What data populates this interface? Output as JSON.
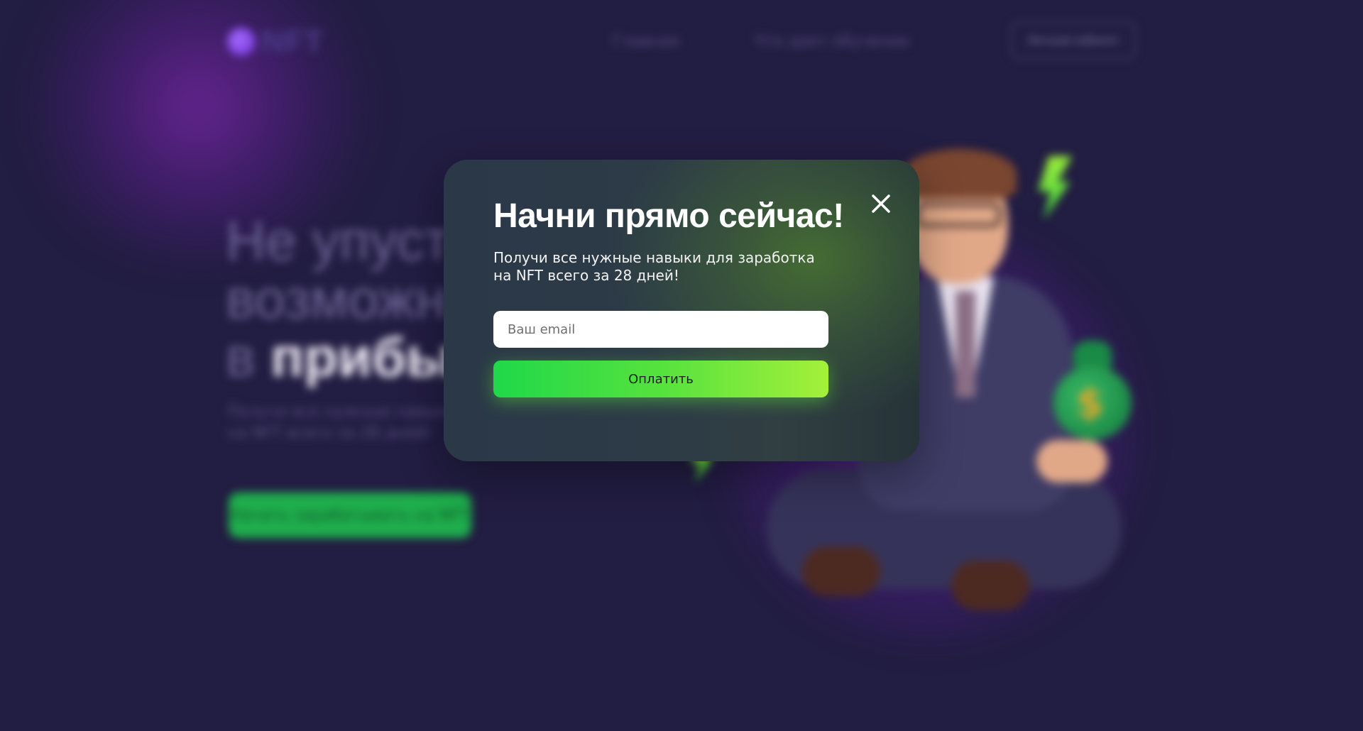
{
  "background": {
    "logo_text": "NFT",
    "nav": [
      "Главная",
      "Что дает обучение"
    ],
    "cabinet_button": "Личный кабинет",
    "hero_title_line1": "Не упусти",
    "hero_title_line2": "возможность",
    "hero_title_line3_prefix": "в ",
    "hero_title_line3_strong": "прибыль",
    "hero_sub_line1": "Получи все нужные навыки",
    "hero_sub_line2": "на NFT всего за 28 дней!",
    "cta_button": "Начать зарабатывать на NFT"
  },
  "modal": {
    "title": "Начни прямо сейчас!",
    "description": "Получи все нужные навыки для заработка на NFT всего за 28 дней!",
    "email_placeholder": "Ваш email",
    "email_value": "",
    "submit_label": "Оплатить",
    "close_icon": "close-icon"
  },
  "colors": {
    "page_background": "#221d42",
    "accent_green_start": "#1fd84a",
    "accent_green_end": "#a4f03a",
    "modal_text": "#ffffff"
  }
}
